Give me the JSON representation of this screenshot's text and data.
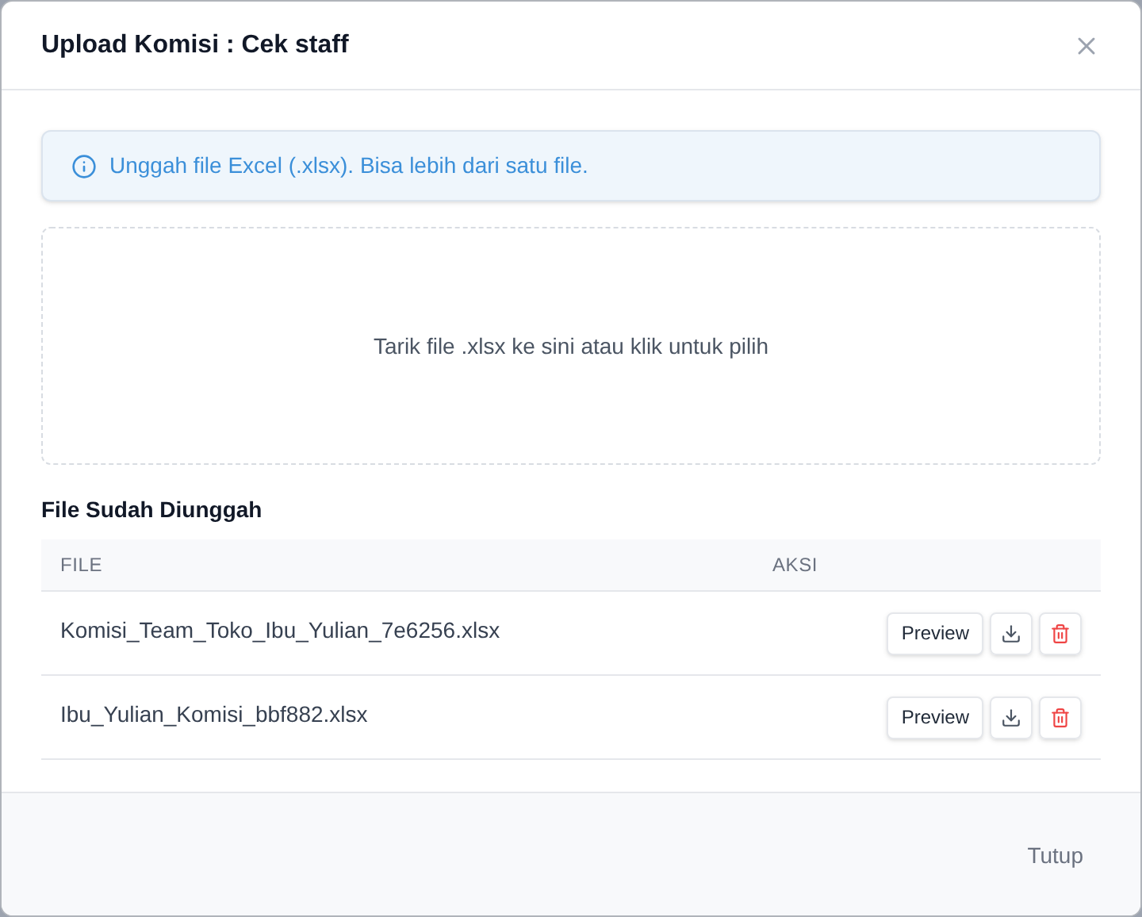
{
  "dialog": {
    "title": "Upload Komisi : Cek staff"
  },
  "alert": {
    "text": "Unggah file Excel (.xlsx). Bisa lebih dari satu file."
  },
  "dropzone": {
    "text": "Tarik file .xlsx ke sini atau klik untuk pilih"
  },
  "uploaded": {
    "heading": "File Sudah Diunggah",
    "columns": [
      "FILE",
      "AKSI"
    ],
    "rows": [
      {
        "file": "Komisi_Team_Toko_Ibu_Yulian_7e6256.xlsx",
        "preview": "Preview"
      },
      {
        "file": "Ibu_Yulian_Komisi_bbf882.xlsx",
        "preview": "Preview"
      }
    ]
  },
  "footer": {
    "close": "Tutup"
  }
}
